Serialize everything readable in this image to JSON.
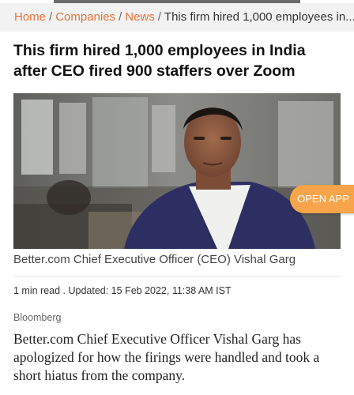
{
  "breadcrumb": {
    "items": [
      "Home",
      "Companies",
      "News"
    ],
    "separator": "/",
    "current": "This firm hired 1,000 employees in..."
  },
  "article": {
    "headline": "This firm hired 1,000 employees in India after CEO fired 900 staffers over Zoom",
    "image_caption": "Better.com Chief Executive Officer (CEO) Vishal Garg",
    "meta": "1 min read . Updated: 15 Feb 2022, 11:38 AM IST",
    "source": "Bloomberg",
    "summary": "Better.com Chief Executive Officer Vishal Garg has apologized for how the firings were handled and took a short hiatus from the company."
  },
  "open_app": {
    "label": "OPEN APP"
  },
  "colors": {
    "accent": "#e8743b",
    "open_app_bg": "#f7a44a",
    "breadcrumb_bg": "#f2f2f2"
  }
}
